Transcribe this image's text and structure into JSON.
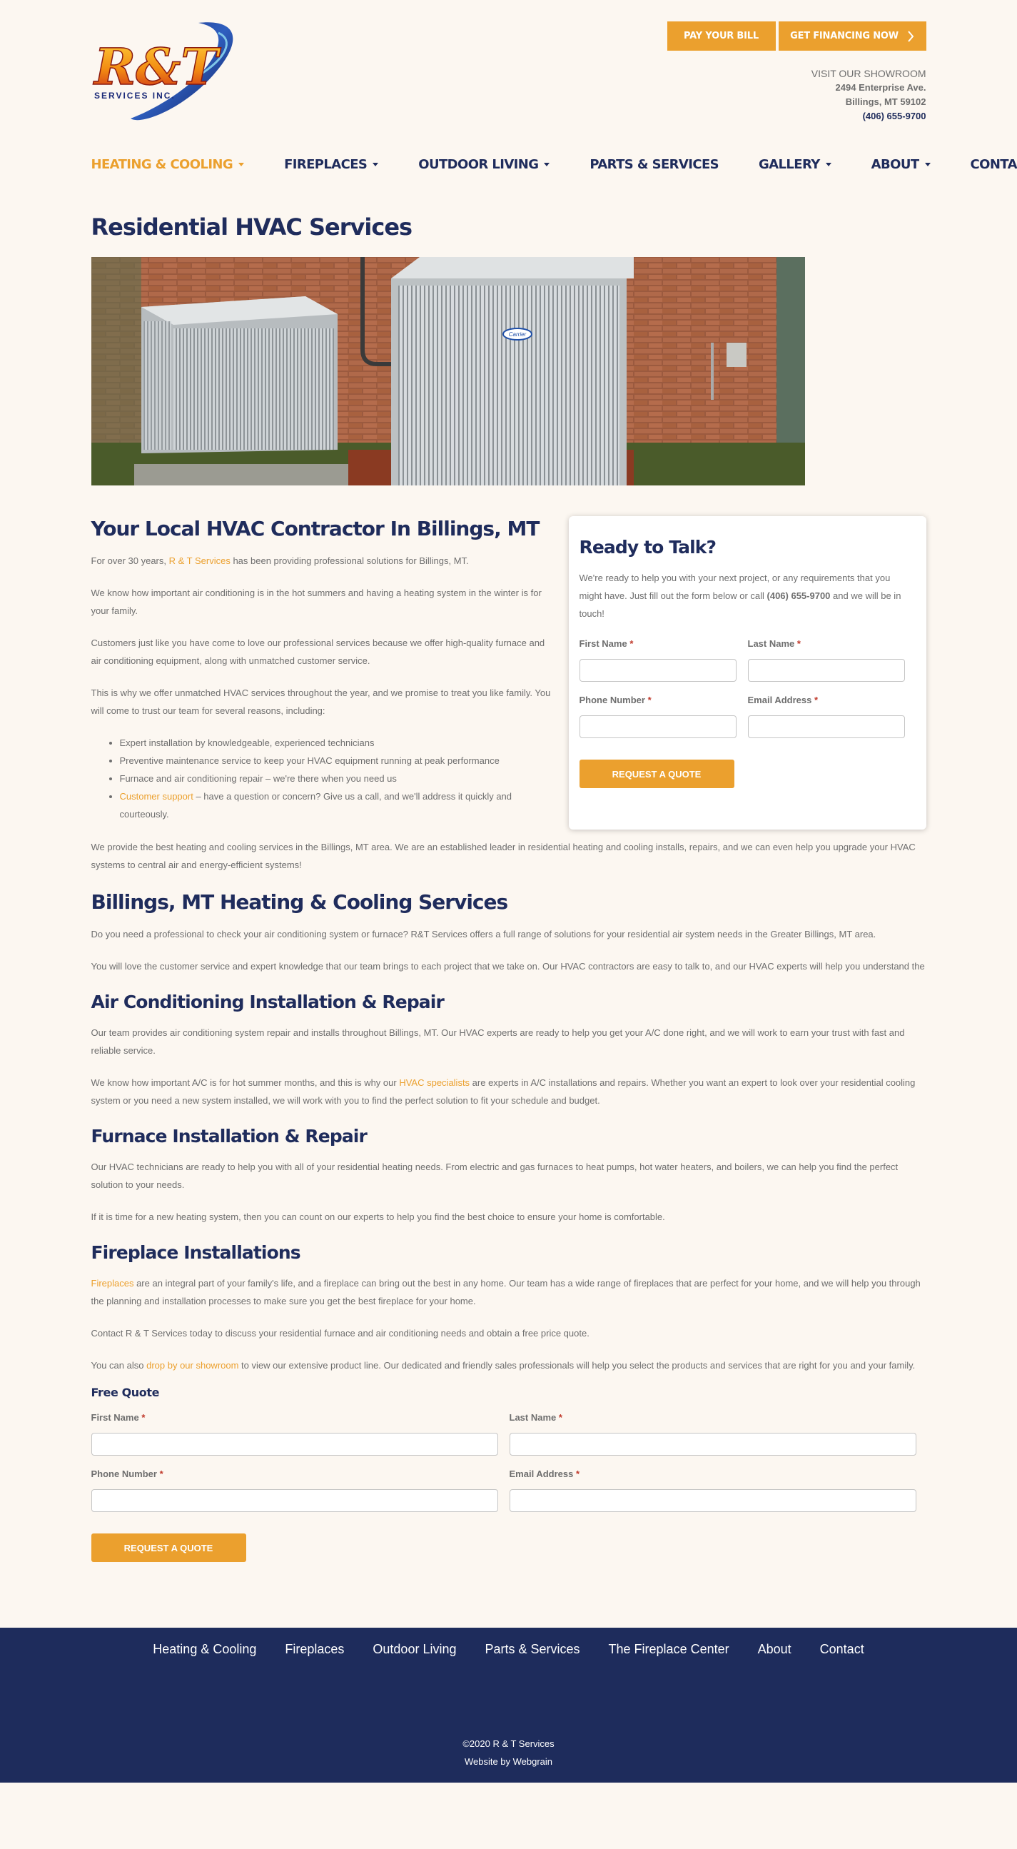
{
  "header": {
    "logo_text": "R&T",
    "logo_subtext": "SERVICES INC.",
    "pay_bill": "PAY YOUR BILL",
    "financing": "GET FINANCING NOW",
    "showroom_label": "VISIT OUR SHOWROOM",
    "address_line1": "2494 Enterprise Ave.",
    "address_line2": "Billings, MT 59102",
    "phone": "(406) 655-9700"
  },
  "nav": [
    {
      "label": "HEATING & COOLING",
      "dropdown": true,
      "active": true
    },
    {
      "label": "FIREPLACES",
      "dropdown": true
    },
    {
      "label": "OUTDOOR LIVING",
      "dropdown": true
    },
    {
      "label": "PARTS & SERVICES",
      "dropdown": false
    },
    {
      "label": "GALLERY",
      "dropdown": true
    },
    {
      "label": "ABOUT",
      "dropdown": true
    },
    {
      "label": "CONTACT",
      "dropdown": false
    }
  ],
  "colors": {
    "accent": "#eba02e",
    "navy": "#1f2c5c",
    "background": "#fcf7f1"
  },
  "page_title": "Residential HVAC Services",
  "hero_brand": "Carrier",
  "section1": {
    "title": "Your Local HVAC Contractor In Billings, MT",
    "p1_before": "For over 30 years, ",
    "p1_link": "R & T Services",
    "p1_after": " has been providing professional solutions for Billings, MT.",
    "p2": "We know how important air conditioning is in the hot summers and having a heating system in the winter is for your family.",
    "p3": "Customers just like you have come to love our professional services because we offer high-quality furnace and air conditioning equipment, along with unmatched customer service.",
    "p4": "This is why we offer unmatched HVAC services throughout the year, and we promise to treat you like family. You will come to trust our team for several reasons, including:",
    "bullets": [
      "Expert installation by knowledgeable, experienced technicians",
      "Preventive maintenance service to keep your HVAC equipment running at peak performance",
      "Furnace and air conditioning repair – we're there when you need us"
    ],
    "bullet4_link": "Customer support",
    "bullet4_text": " – have a question or concern? Give us a call, and we'll address it quickly and courteously.",
    "p5": "We provide the best heating and cooling services in the Billings, MT area. We are an established leader in residential heating and cooling installs, repairs, and we can even help you upgrade your HVAC systems to central air and energy-efficient systems!"
  },
  "card": {
    "title": "Ready to Talk?",
    "text_before": "We're ready to help you with your next project, or any requirements that you might have. Just fill out the form below or call ",
    "text_phone": "(406) 655-9700",
    "text_after": " and we will be in touch!",
    "first_name": "First Name",
    "last_name": "Last Name",
    "phone": "Phone Number",
    "email": "Email Address",
    "required": "*",
    "button": "REQUEST A QUOTE"
  },
  "section2": {
    "title": "Billings, MT Heating & Cooling Services",
    "p1": "Do you need a professional to check your air conditioning system or furnace? R&T Services offers a full range of solutions for your residential air system needs in the Greater Billings, MT area.",
    "p2": "You will love the customer service and expert knowledge that our team brings to each project that we take on. Our HVAC contractors are easy to talk to, and our HVAC experts will help you understand the"
  },
  "section3": {
    "title": "Air Conditioning Installation & Repair",
    "p1": "Our team provides air conditioning system repair and installs throughout Billings, MT. Our HVAC experts are ready to help you get your A/C done right, and we will work to earn your trust with fast and reliable service.",
    "p2_before": "We know how important A/C is for hot summer months, and this is why our ",
    "p2_link": "HVAC specialists",
    "p2_after": " are experts in A/C installations and repairs. Whether you want an expert to look over your residential cooling system or you need a new system installed, we will work with you to find the perfect solution to fit your schedule and budget."
  },
  "section4": {
    "title": "Furnace Installation & Repair",
    "p1": "Our HVAC technicians are ready to help you with all of your residential heating needs. From electric and gas furnaces to heat pumps, hot water heaters, and boilers, we can help you find the perfect solution to your needs.",
    "p2": "If it is time for a new heating system, then you can count on our experts to help you find the best choice to ensure your home is comfortable."
  },
  "section5": {
    "title": "Fireplace Installations",
    "p1_link": "Fireplaces",
    "p1_after": " are an integral part of your family's life, and a fireplace can bring out the best in any home. Our team has a wide range of fireplaces that are perfect for your home, and we will help you through the planning and installation processes to make sure you get the best fireplace for your home.",
    "p2": "Contact R & T Services today to discuss your residential furnace and air conditioning needs and obtain a free price quote.",
    "p3_before": "You can also ",
    "p3_link": "drop by our showroom",
    "p3_after": " to view our extensive product line. Our dedicated and friendly sales professionals will help you select the products and services that are right for you and your family."
  },
  "free_quote": {
    "title": "Free Quote",
    "first_name": "First Name",
    "last_name": "Last Name",
    "phone": "Phone Number",
    "email": "Email Address",
    "required": "*",
    "button": "REQUEST A QUOTE"
  },
  "footer": {
    "links": [
      "Heating & Cooling",
      "Fireplaces",
      "Outdoor Living",
      "Parts & Services",
      "The Fireplace Center",
      "About",
      "Contact"
    ],
    "copyright": "©2020 R & T Services",
    "credit": "Website by Webgrain"
  }
}
